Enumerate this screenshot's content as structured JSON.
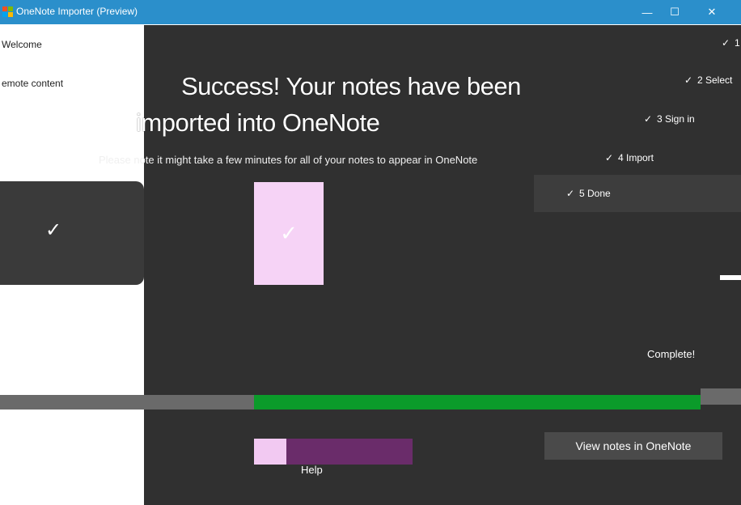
{
  "window": {
    "title": "OneNote Importer (Preview)",
    "controls": {
      "minimize_icon": "minimize-icon",
      "maximize_icon": "maximize-icon",
      "close_icon": "close-icon"
    }
  },
  "sidebar": {
    "items": [
      {
        "label": "Welcome"
      },
      {
        "label": "emote content"
      }
    ]
  },
  "steps": [
    {
      "label": "1",
      "done": true
    },
    {
      "label": "2 Select",
      "done": true
    },
    {
      "label": "3 Sign in",
      "done": true
    },
    {
      "label": "4 Import",
      "done": true
    },
    {
      "label": "5 Done",
      "done": true,
      "current": true
    }
  ],
  "main": {
    "headline_line1": "Success! Your notes have been",
    "headline_line2": "imported into OneNote",
    "subtext": "Please note it might take a few minutes for all of your notes to appear in OneNote",
    "status": "Complete!",
    "progress_percent": 100
  },
  "buttons": {
    "view_notes": "View notes in OneNote",
    "help": "Help"
  },
  "colors": {
    "titlebar": "#2b8fcb",
    "dark_bg": "#303030",
    "progress_fill": "#0b9b2a",
    "progress_track": "#8ef08e",
    "tile": "#f6d3f6"
  }
}
